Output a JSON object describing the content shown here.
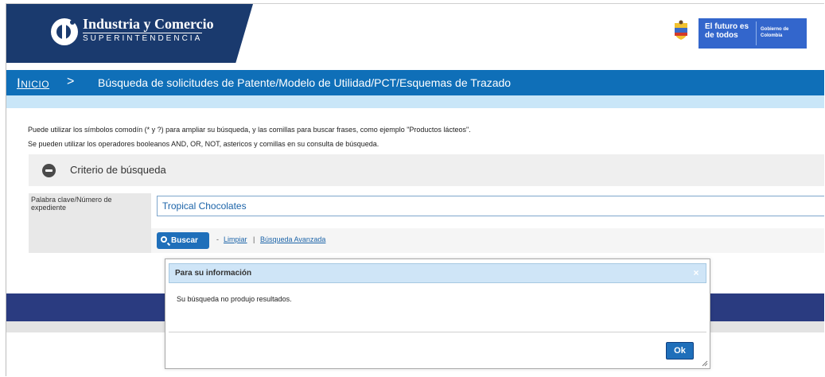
{
  "header": {
    "logo_title": "Industria y Comercio",
    "logo_subtitle": "SUPERINTENDENCIA",
    "gov_slogan": "El futuro es de todos",
    "gov_name": "Gobierno de Colombia",
    "brand_color": "#1a3a6e"
  },
  "titlebar": {
    "home_link": "Inicio",
    "arrow": ">",
    "title": "Búsqueda de solicitudes de Patente/Modelo de Utilidad/PCT/Esquemas de Trazado",
    "color": "#0f6fb8"
  },
  "info": {
    "line1": "Puede utilizar los símbolos comodín (* y ?) para ampliar su búsqueda, y las comillas para buscar frases, como ejemplo \"Productos lácteos\".",
    "line2": "Se pueden utilizar los operadores booleanos AND, OR, NOT, astericos y comillas en su consulta de búsqueda."
  },
  "criteria": {
    "header_label": "Criterio de búsqueda",
    "keyword_label": "Palabra clave/Número de expediente",
    "keyword_value": "Tropical Chocolates",
    "search_button": "Buscar",
    "separator1": "-",
    "clear_link": "Limpiar",
    "separator2": "|",
    "advanced_link": "Búsqueda Avanzada"
  },
  "dialog": {
    "title": "Para su información",
    "close": "×",
    "message": "Su búsqueda no produjo resultados.",
    "ok_button": "Ok"
  }
}
